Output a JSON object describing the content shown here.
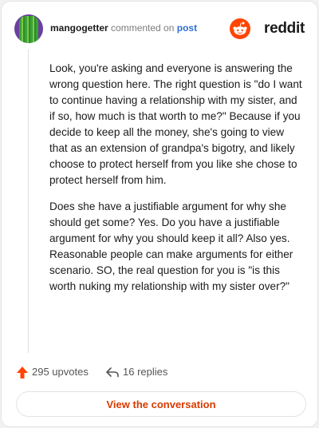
{
  "header": {
    "username": "mangogetter",
    "action_text": "commented on",
    "post_link": "post",
    "brand_name": "reddit",
    "avatar_icon": "cactus-avatar-icon",
    "brand_icon": "reddit-alien-icon"
  },
  "comment": {
    "paragraphs": [
      "Look, you're asking and everyone is answering the wrong question here. The right question is \"do I want to continue having a relationship with my sister, and if so, how much is that worth to me?\" Because if you decide to keep all the money, she's going to view that as an extension of grandpa's bigotry, and likely choose to protect herself from you like she chose to protect herself from him.",
      "Does she have a justifiable argument for why she should get some? Yes. Do you have a justifiable argument for why you should keep it all? Also yes. Reasonable people can make arguments for either scenario. SO, the real question for you is \"is this worth nuking my relationship with my sister over?\""
    ]
  },
  "stats": {
    "upvotes_label": "295 upvotes",
    "replies_label": "16 replies",
    "upvote_icon": "upvote-arrow-icon",
    "reply_icon": "reply-arrow-icon"
  },
  "actions": {
    "view_conversation_label": "View the conversation"
  },
  "colors": {
    "accent": "#d93a00",
    "upvote": "#ff4500",
    "link": "#2f6fd6",
    "text": "#1a1a1b",
    "muted": "#7c7c7c"
  }
}
